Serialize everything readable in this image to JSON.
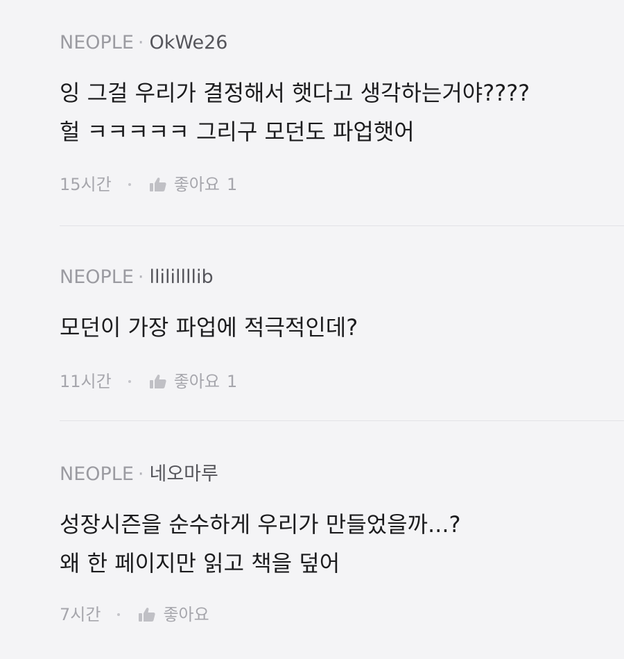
{
  "comments": [
    {
      "org": "NEOPLE",
      "separator": "·",
      "user": "OkWe26",
      "lines": [
        "잉 그걸 우리가 결정해서 햇다고 생각하는거야????",
        "헐 ㅋㅋㅋㅋㅋ 그리구 모던도 파업햇어"
      ],
      "time": "15시간",
      "like_label": "좋아요",
      "like_count": "1"
    },
    {
      "org": "NEOPLE",
      "separator": "·",
      "user": "llilillllib",
      "lines": [
        "모던이 가장 파업에 적극적인데?"
      ],
      "time": "11시간",
      "like_label": "좋아요",
      "like_count": "1"
    },
    {
      "org": "NEOPLE",
      "separator": "·",
      "user": "네오마루",
      "lines": [
        "성장시즌을 순수하게 우리가 만들었을까...?",
        "왜 한 페이지만 읽고 책을 덮어"
      ],
      "time": "7시간",
      "like_label": "좋아요",
      "like_count": ""
    }
  ],
  "icons": {
    "like": "thumbs-up-icon"
  },
  "colors": {
    "background": "#f4f4f6",
    "body_text": "#1c1c1e",
    "muted_text": "#a6a6ac"
  }
}
